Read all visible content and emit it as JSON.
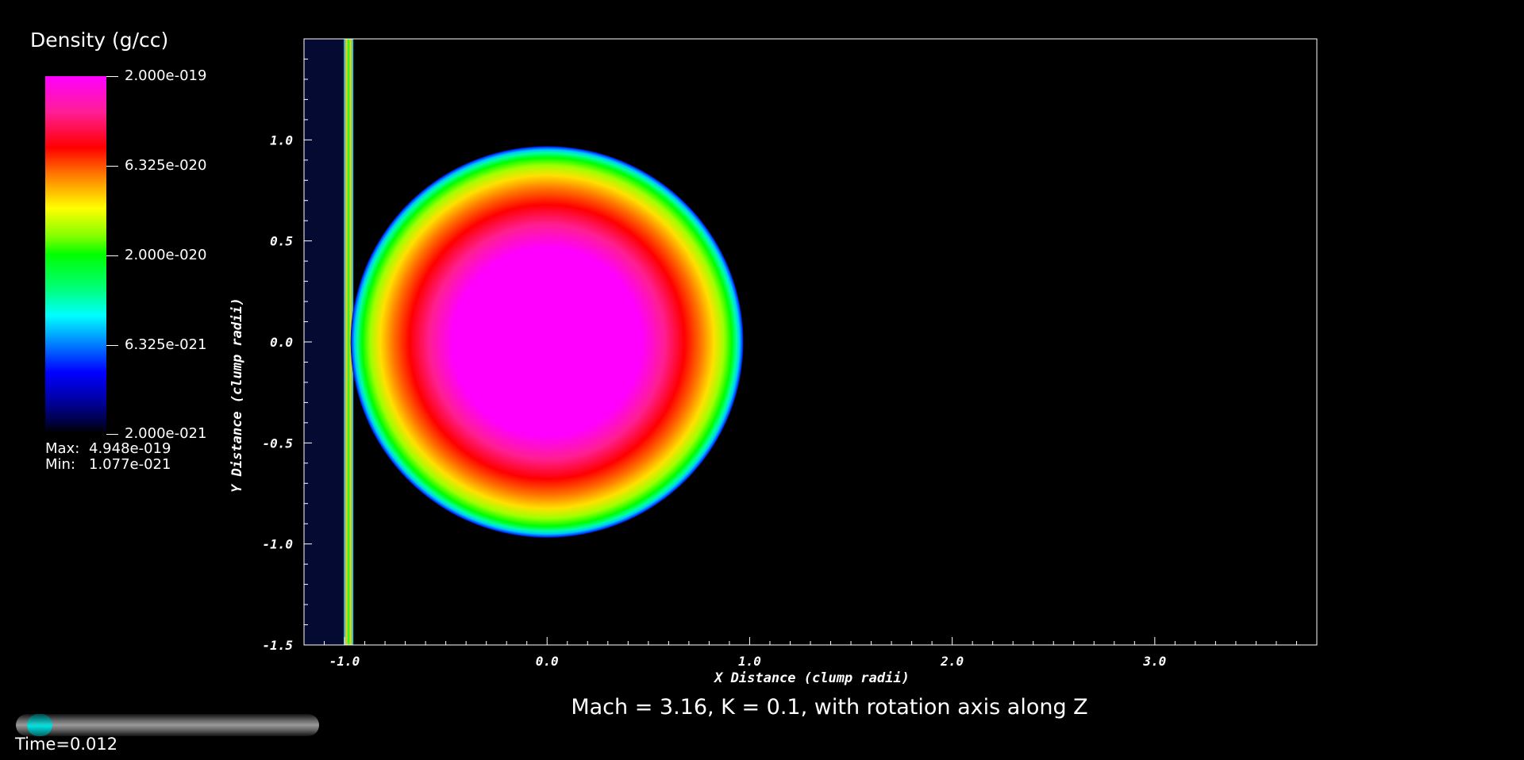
{
  "legend": {
    "title": "Density (g/cc)",
    "ticks": [
      "2.000e-019",
      "6.325e-020",
      "2.000e-020",
      "6.325e-021",
      "2.000e-021"
    ],
    "max_label": "Max:",
    "max_value": "4.948e-019",
    "min_label": "Min:",
    "min_value": "1.077e-021"
  },
  "plot": {
    "title": "Mach = 3.16, K = 0.1, with rotation axis along Z",
    "xlabel": "X Distance (clump radii)",
    "ylabel": "Y Distance (clump radii)",
    "x_ticks": [
      "-1.0",
      "0.0",
      "1.0",
      "2.0",
      "3.0"
    ],
    "y_ticks": [
      "1.0",
      "0.5",
      "0.0",
      "-0.5",
      "-1.0",
      "-1.5"
    ],
    "xlim": [
      -1.2,
      3.8
    ],
    "ylim": [
      -1.5,
      1.5
    ],
    "clump": {
      "center_x": 0.0,
      "center_y": 0.0,
      "radius": 0.97
    },
    "shock_front_x": -0.98
  },
  "time_slider": {
    "label": "Time=0.012",
    "progress": 0.04
  }
}
